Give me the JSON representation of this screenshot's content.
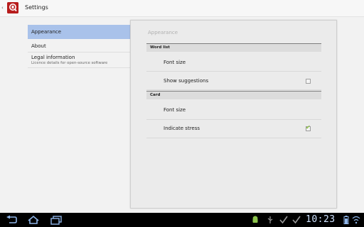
{
  "actionbar": {
    "title": "Settings",
    "icon": "app-logo-icon"
  },
  "headers": [
    {
      "title": "Appearance",
      "summary": "",
      "selected": true
    },
    {
      "title": "About",
      "summary": "",
      "selected": false
    },
    {
      "title": "Legal information",
      "summary": "Licence details for open-source software",
      "selected": false
    }
  ],
  "panel": {
    "title": "Appearance",
    "categories": [
      {
        "title": "Word list",
        "items": [
          {
            "label": "Font size",
            "checkbox": null
          },
          {
            "label": "Show suggestions",
            "checkbox": false
          }
        ]
      },
      {
        "title": "Card",
        "items": [
          {
            "label": "Font size",
            "checkbox": null
          },
          {
            "label": "Indicate stress",
            "checkbox": true
          }
        ]
      }
    ]
  },
  "systembar": {
    "time": "10:23",
    "icons": [
      "back-icon",
      "home-icon",
      "recent-apps-icon",
      "android-debug-icon",
      "usb-icon",
      "check-icon",
      "check-icon",
      "battery-icon",
      "wifi-icon"
    ]
  },
  "colors": {
    "selected_header": "#a9c2ea",
    "checkbox_tick": "#8cc63f",
    "app_icon": "#b71c1c",
    "clock": "#cfe3ff"
  }
}
